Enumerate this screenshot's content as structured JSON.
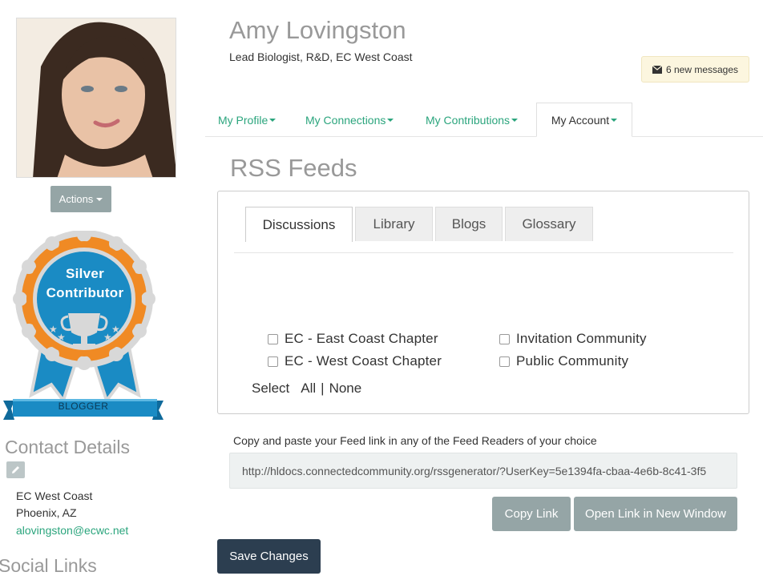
{
  "profile": {
    "name": "Amy Lovingston",
    "role": "Lead Biologist, R&D, EC West Coast",
    "actions_label": "Actions"
  },
  "messages": {
    "label": "6 new messages",
    "icon": "envelope-icon"
  },
  "badge": {
    "line1": "Silver",
    "line2": "Contributor",
    "ribbon": "BLOGGER",
    "colors": {
      "orange": "#f08a24",
      "blue": "#1a8bc4",
      "silver": "#d8d8d8",
      "dark_blue": "#0f6a9b"
    }
  },
  "contact": {
    "title": "Contact Details",
    "company": "EC West Coast",
    "location": "Phoenix, AZ",
    "email": "alovingston@ecwc.net"
  },
  "social": {
    "title": "Social Links"
  },
  "nav": {
    "tabs": [
      {
        "label": "My Profile"
      },
      {
        "label": "My Connections"
      },
      {
        "label": "My Contributions"
      },
      {
        "label": "My Account"
      }
    ],
    "active_index": 3
  },
  "page_title": "RSS Feeds",
  "rss": {
    "tabs": [
      {
        "label": "Discussions"
      },
      {
        "label": "Library"
      },
      {
        "label": "Blogs"
      },
      {
        "label": "Glossary"
      }
    ],
    "communities": [
      {
        "label": "EC - East Coast Chapter",
        "checked": false
      },
      {
        "label": "EC - West Coast Chapter",
        "checked": false
      },
      {
        "label": "Invitation Community",
        "checked": false
      },
      {
        "label": "Public Community",
        "checked": false
      }
    ],
    "select_label": "Select",
    "select_all": "All",
    "select_separator": "|",
    "select_none": "None"
  },
  "feed": {
    "label": "Copy and paste your Feed link in any of the Feed Readers of your choice",
    "url": "http://hldocs.connectedcommunity.org/rssgenerator/?UserKey=5e1394fa-cbaa-4e6b-8c41-3f5",
    "copy_label": "Copy Link",
    "open_label": "Open Link in New Window"
  },
  "save_label": "Save Changes",
  "colors": {
    "accent": "#2ba57d",
    "button_grey": "#95a5a6",
    "button_dark": "#2c3e50"
  }
}
